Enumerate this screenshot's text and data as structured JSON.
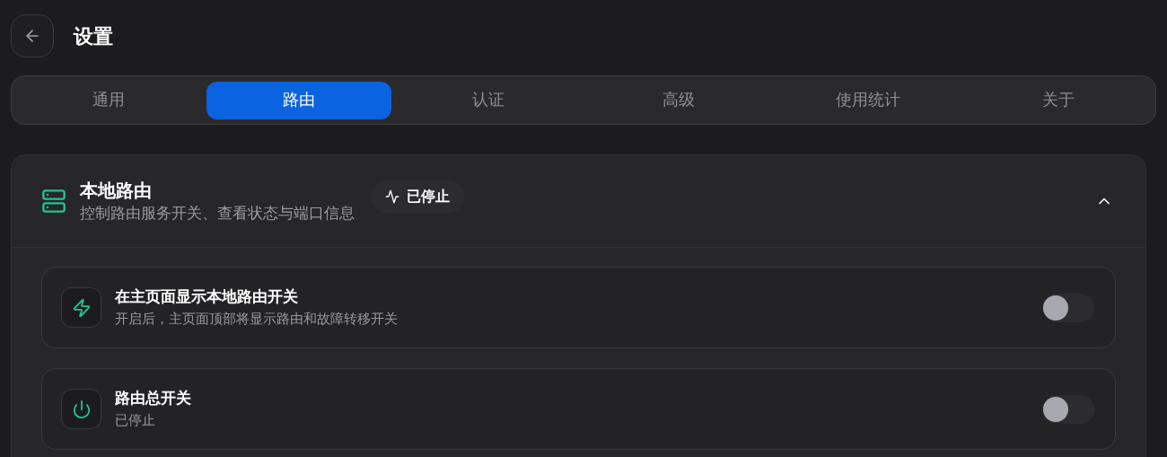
{
  "header": {
    "title": "设置"
  },
  "tabs": [
    {
      "label": "通用",
      "selected": false
    },
    {
      "label": "路由",
      "selected": true
    },
    {
      "label": "认证",
      "selected": false
    },
    {
      "label": "高级",
      "selected": false
    },
    {
      "label": "使用统计",
      "selected": false
    },
    {
      "label": "关于",
      "selected": false
    }
  ],
  "section": {
    "title": "本地路由",
    "subtitle": "控制路由服务开关、查看状态与端口信息",
    "status": "已停止",
    "expanded": true,
    "rows": [
      {
        "kind": "zap",
        "title": "在主页面显示本地路由开关",
        "description": "开启后，主页面顶部将显示路由和故障转移开关",
        "on": false
      },
      {
        "kind": "power",
        "title": "路由总开关",
        "description": "已停止",
        "on": false
      }
    ]
  }
}
